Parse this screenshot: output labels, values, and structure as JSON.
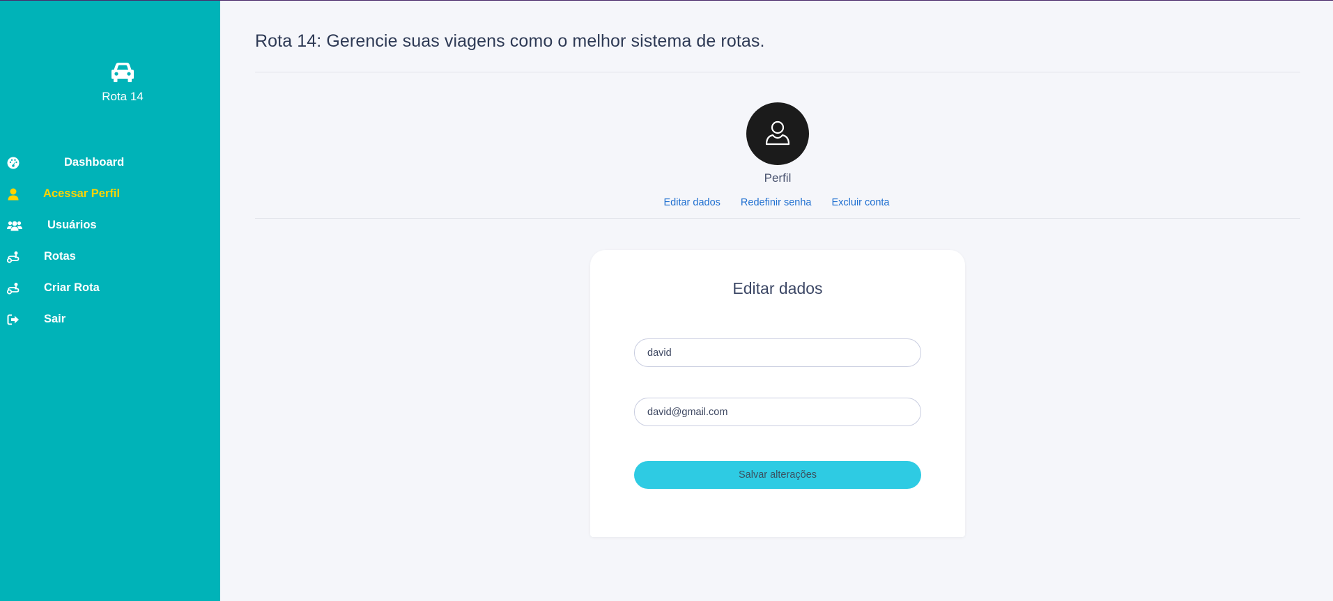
{
  "sidebar": {
    "brand": {
      "name": "Rota 14",
      "icon": "car-icon"
    },
    "items": [
      {
        "label": "Dashboard",
        "icon": "gauge-icon",
        "active": false
      },
      {
        "label": "Acessar Perfil",
        "icon": "user-icon",
        "active": true
      },
      {
        "label": "Usuários",
        "icon": "users-icon",
        "active": false
      },
      {
        "label": "Rotas",
        "icon": "route-icon",
        "active": false
      },
      {
        "label": "Criar Rota",
        "icon": "route-icon",
        "active": false
      },
      {
        "label": "Sair",
        "icon": "sign-out-icon",
        "active": false
      }
    ],
    "bg_color": "#00b3b8",
    "active_color": "#ffd400"
  },
  "header": {
    "title": "Rota 14: Gerencie suas viagens como o melhor sistema de rotas."
  },
  "profile": {
    "avatar_icon": "user-outline-icon",
    "label": "Perfil",
    "links": [
      "Editar dados",
      "Redefinir senha",
      "Excluir conta"
    ]
  },
  "form": {
    "title": "Editar dados",
    "name_value": "david",
    "email_value": "david@gmail.com",
    "save_label": "Salvar alterações",
    "button_color": "#2ecbe3"
  }
}
